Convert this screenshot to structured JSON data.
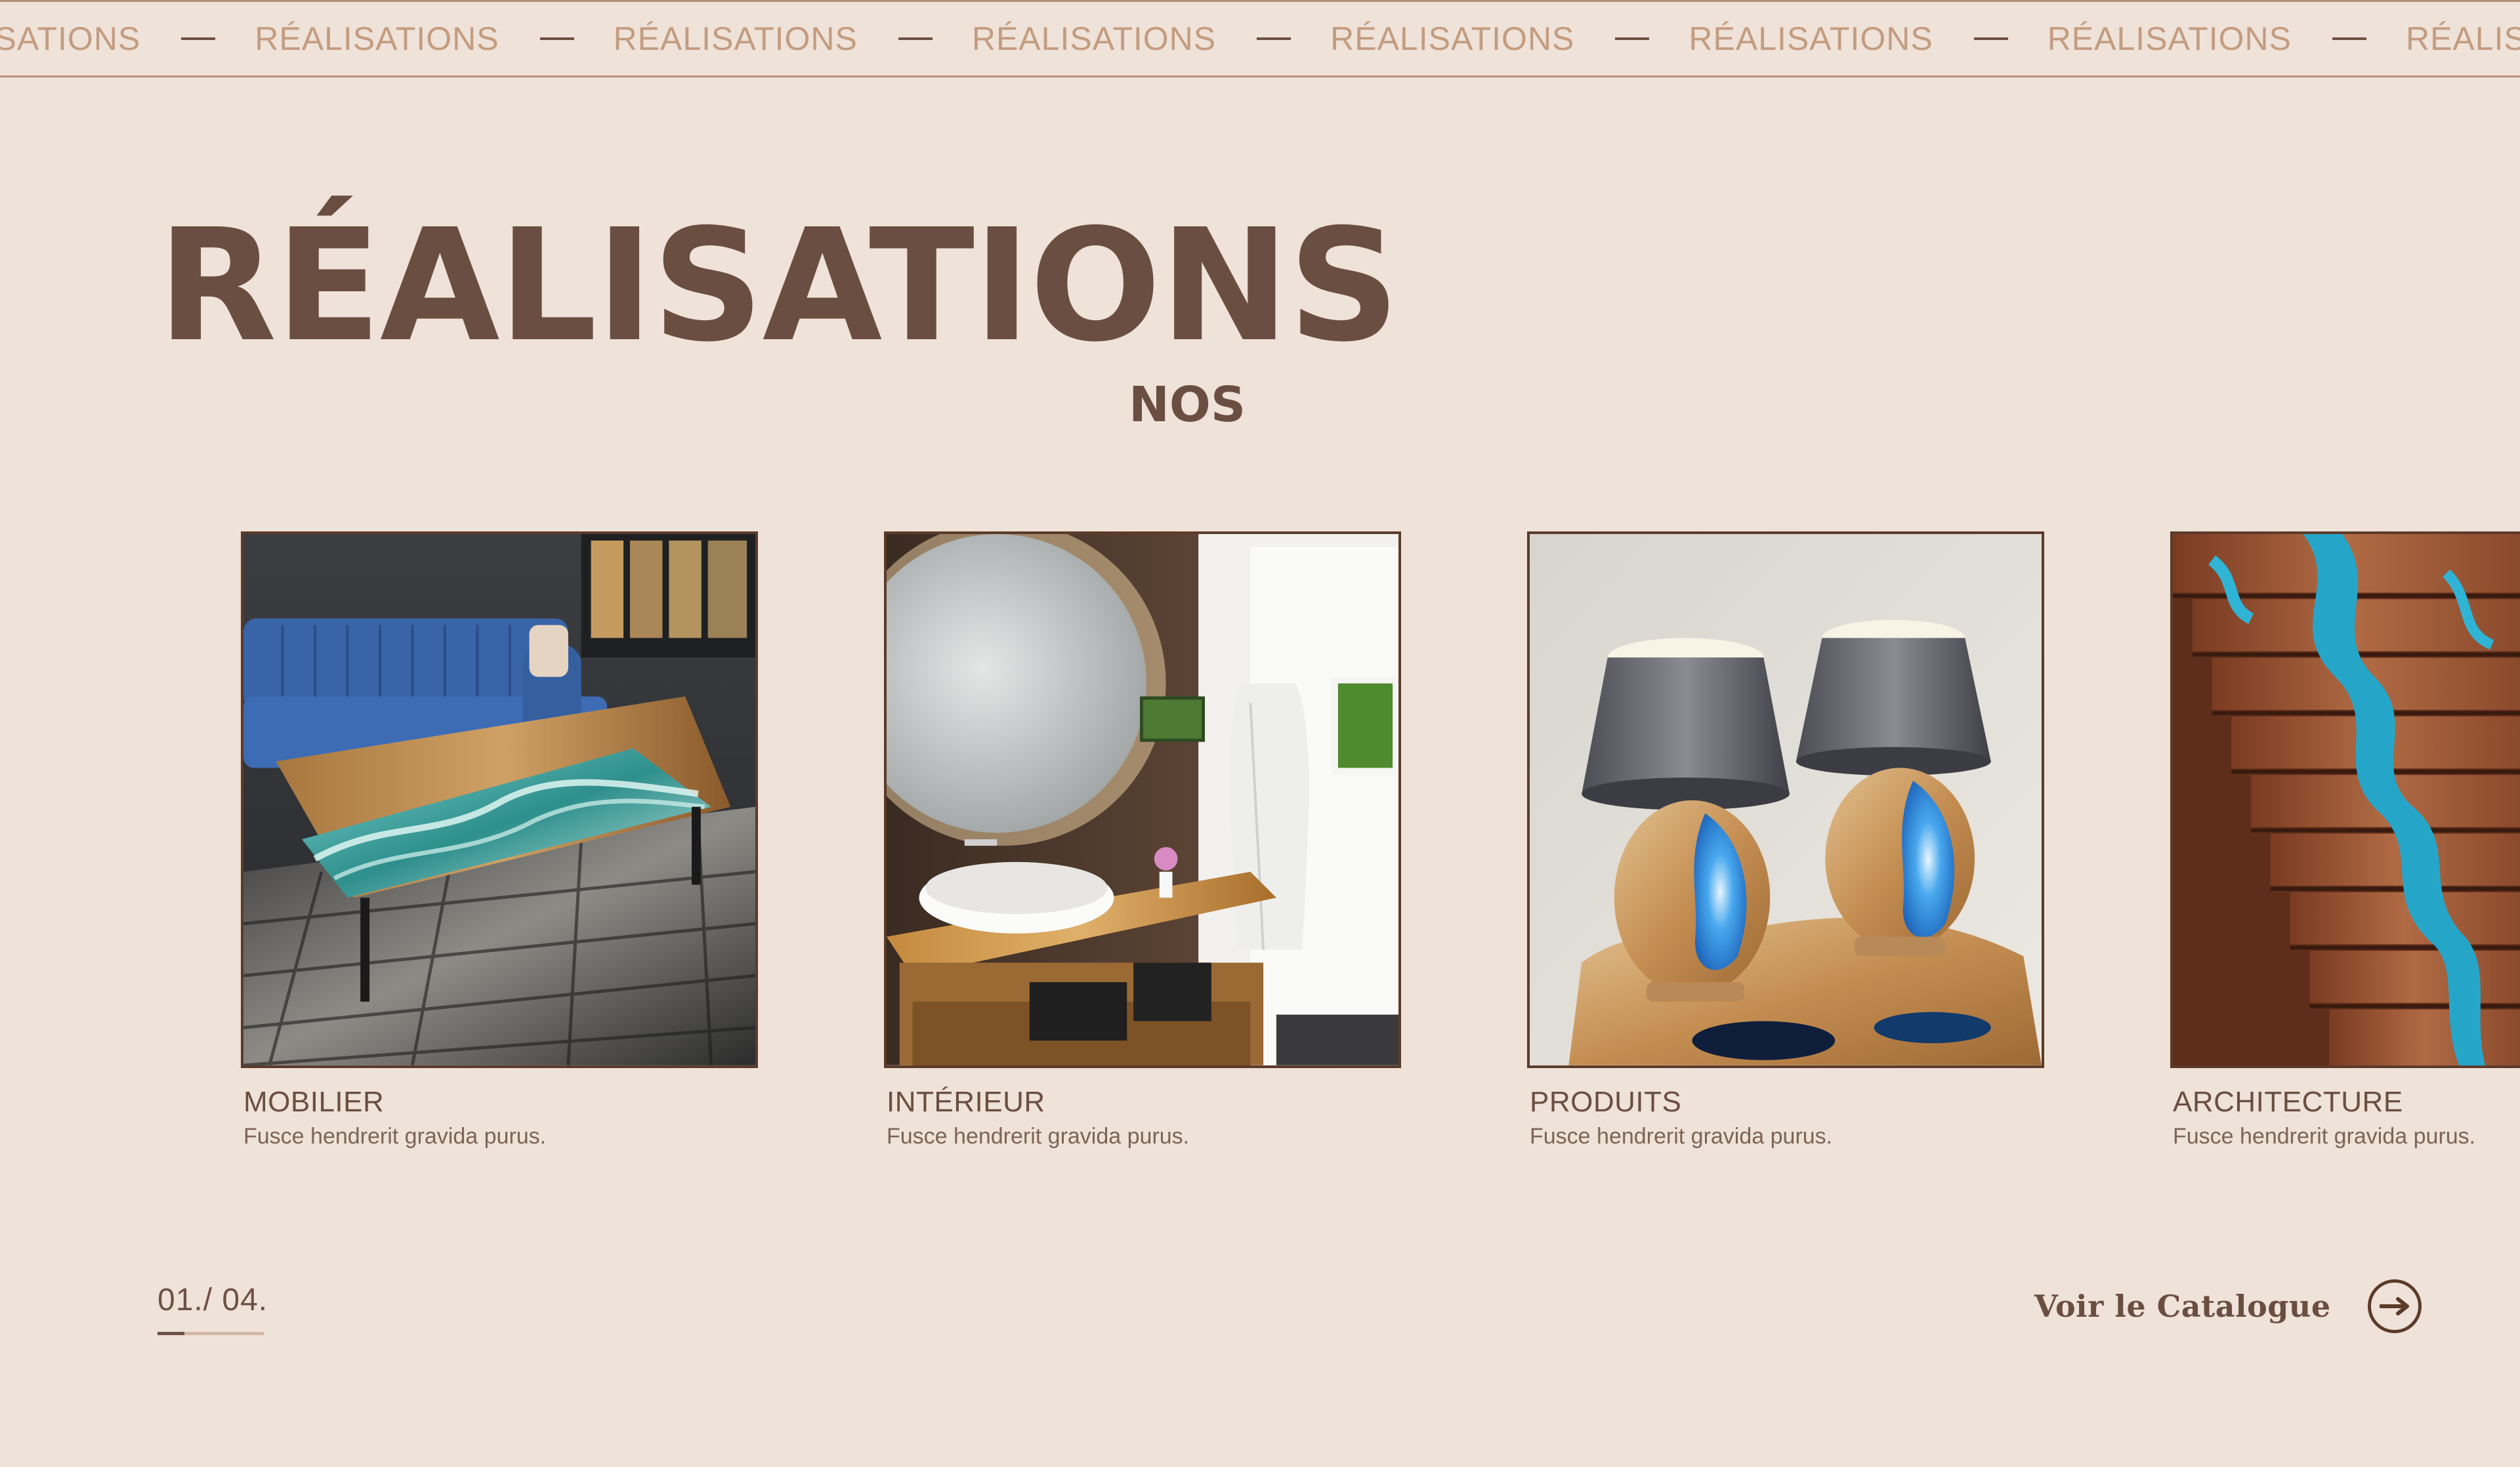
{
  "marquee": {
    "items": [
      "RÉALISATIONS",
      "RÉALISATIONS",
      "RÉALISATIONS",
      "RÉALISATIONS",
      "RÉALISATIONS",
      "RÉALISATIONS",
      "RÉALISATIONS",
      "RÉALISATIONS"
    ]
  },
  "heading": {
    "title": "RÉALISATIONS",
    "subtitle": "NOS"
  },
  "gallery": {
    "cards": [
      {
        "title": "MOBILIER",
        "description": "Fusce hendrerit gravida purus."
      },
      {
        "title": "INTÉRIEUR",
        "description": "Fusce hendrerit gravida purus."
      },
      {
        "title": "PRODUITS",
        "description": "Fusce hendrerit gravida purus."
      },
      {
        "title": "ARCHITECTURE",
        "description": "Fusce hendrerit gravida purus."
      }
    ]
  },
  "pagination": {
    "label": "01./ 04.",
    "progress": 0.25
  },
  "catalogue": {
    "label": "Voir le Catalogue",
    "icon": "arrow-right-icon"
  },
  "colors": {
    "background": "#efe2d8",
    "text_dark": "#6b4e42",
    "marquee_text": "#c39c80",
    "border": "#5c3b2a"
  }
}
